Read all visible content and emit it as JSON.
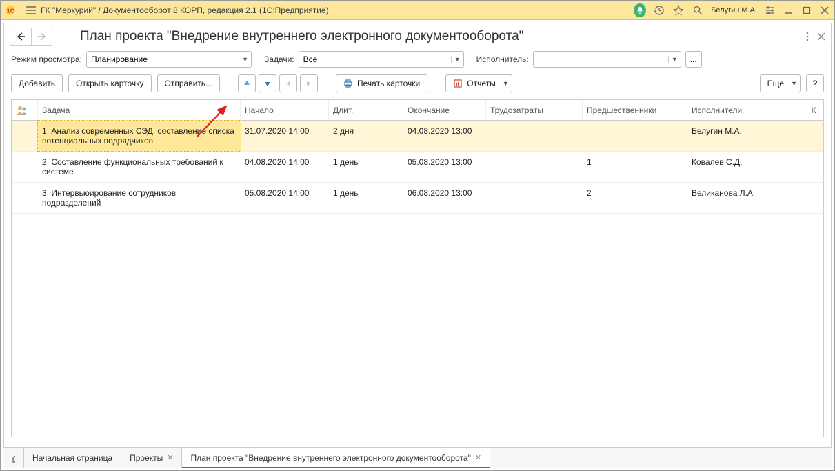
{
  "titlebar": {
    "title": "ГК \"Меркурий\" / Документооборот 8 КОРП, редакция 2.1  (1С:Предприятие)",
    "user": "Белугин М.А."
  },
  "page": {
    "title": "План проекта \"Внедрение внутреннего электронного документооборота\""
  },
  "filters": {
    "mode_label": "Режим просмотра:",
    "mode_value": "Планирование",
    "tasks_label": "Задачи:",
    "tasks_value": "Все",
    "assignee_label": "Исполнитель:",
    "assignee_value": "",
    "more_btn": "..."
  },
  "toolbar": {
    "add": "Добавить",
    "open_card": "Открыть карточку",
    "send": "Отправить...",
    "print_card": "Печать карточки",
    "reports": "Отчеты",
    "more": "Еще",
    "help": "?"
  },
  "grid": {
    "headers": {
      "icon": "",
      "task": "Задача",
      "start": "Начало",
      "duration": "Длит.",
      "end": "Окончание",
      "effort": "Трудозатраты",
      "pred": "Предшественники",
      "assignees": "Исполнители",
      "k": "К"
    },
    "rows": [
      {
        "num": "1",
        "task": "Анализ современных СЭД, составление списка потенциальных подрядчиков",
        "start": "31.07.2020 14:00",
        "duration": "2 дня",
        "end": "04.08.2020 13:00",
        "effort": "",
        "pred": "",
        "assignees": "Белугин М.А.",
        "selected": true
      },
      {
        "num": "2",
        "task": "Составление функциональных требований к системе",
        "start": "04.08.2020 14:00",
        "duration": "1 день",
        "end": "05.08.2020 13:00",
        "effort": "",
        "pred": "1",
        "assignees": "Ковалев С.Д.",
        "selected": false
      },
      {
        "num": "3",
        "task": "Интервьюирование сотрудников подразделений",
        "start": "05.08.2020 14:00",
        "duration": "1 день",
        "end": "06.08.2020 13:00",
        "effort": "",
        "pred": "2",
        "assignees": "Великанова Л.А.",
        "selected": false
      }
    ]
  },
  "tabs": {
    "start": "Начальная страница",
    "projects": "Проекты",
    "plan": "План проекта \"Внедрение внутреннего электронного документооборота\""
  }
}
